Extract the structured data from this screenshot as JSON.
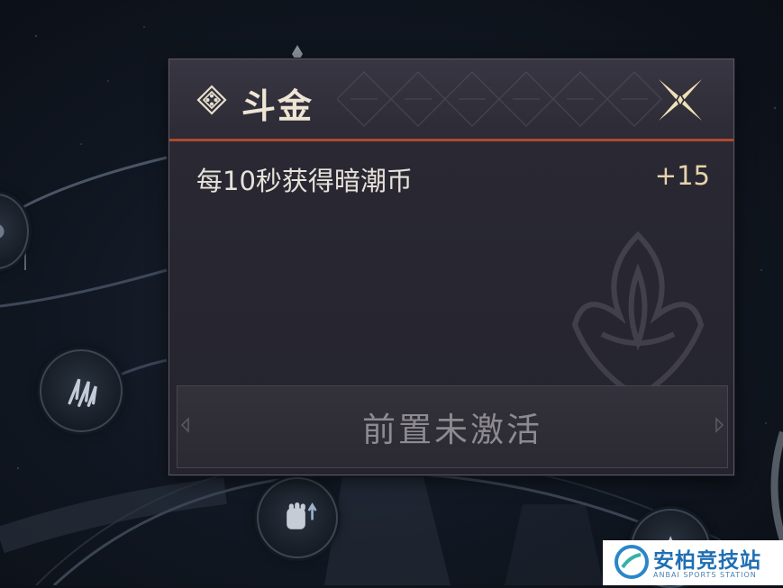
{
  "popup": {
    "title": "斗金",
    "effect": {
      "label": "每10秒获得暗潮币",
      "value": "+15"
    },
    "action_button": {
      "label": "前置未激活",
      "state": "disabled"
    }
  },
  "site_logo": {
    "name": "安柏竞技站",
    "subtitle": "ANBAI SPORTS STATION"
  },
  "colors": {
    "accent_line": "#b0482e",
    "title_text": "#eee5d4",
    "value_text": "#e6d3ab",
    "disabled_text": "#8d8a90",
    "logo_blue": "#1f6fb3"
  },
  "icons": [
    "diamond-emblem-icon",
    "close-x-icon",
    "skill-claw-icon",
    "skill-fist-icon",
    "skill-node-icon"
  ]
}
